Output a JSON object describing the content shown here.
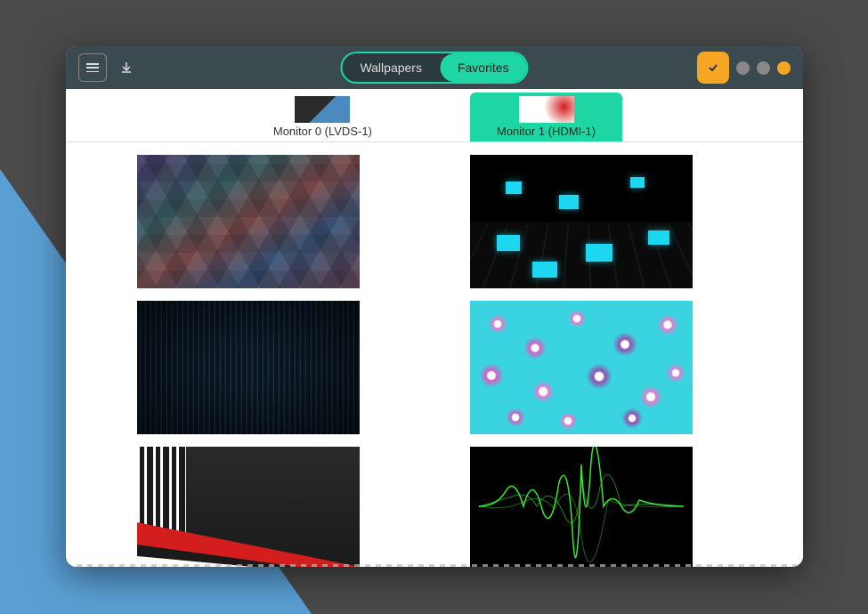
{
  "tabs": {
    "wallpapers": "Wallpapers",
    "favorites": "Favorites",
    "active": "favorites"
  },
  "monitors": [
    {
      "label": "Monitor 0 (LVDS-1)",
      "active": false
    },
    {
      "label": "Monitor 1 (HDMI-1)",
      "active": true
    }
  ],
  "icons": {
    "menu": "menu-icon",
    "download": "download-icon",
    "check": "check-icon"
  },
  "colors": {
    "accent": "#1dd6a3",
    "amber": "#f5a623",
    "titlebar": "#3a4a4f"
  },
  "wallpapers": [
    {
      "name": "geometric-hexagons"
    },
    {
      "name": "3d-cubes-black-cyan"
    },
    {
      "name": "blue-vertical-stripes"
    },
    {
      "name": "cherry-blossoms-pink-cyan"
    },
    {
      "name": "red-black-abstract-lines"
    },
    {
      "name": "green-soundwave-black"
    }
  ]
}
